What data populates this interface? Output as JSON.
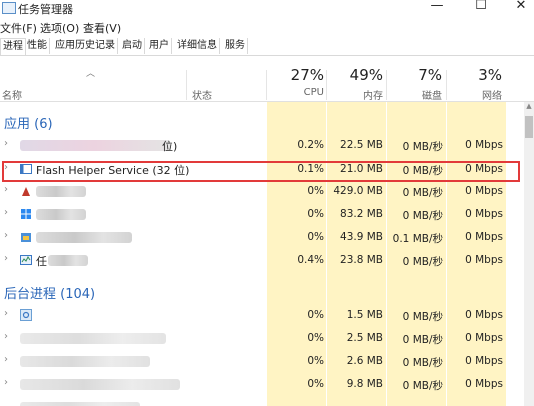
{
  "window": {
    "title": "任务管理器",
    "minimize": "—",
    "maximize": "☐",
    "close": "✕"
  },
  "menu": [
    "文件(F)",
    "选项(O)",
    "查看(V)"
  ],
  "tabs": [
    "进程",
    "性能",
    "应用历史记录",
    "启动",
    "用户",
    "详细信息",
    "服务"
  ],
  "header": {
    "name": "名称",
    "status": "状态",
    "cpu_pct": "27%",
    "cpu": "CPU",
    "mem_pct": "49%",
    "mem": "内存",
    "disk_pct": "7%",
    "disk": "磁盘",
    "net_pct": "3%",
    "net": "网络"
  },
  "groups": {
    "apps": "应用 (6)",
    "background": "后台进程 (104)"
  },
  "apps": [
    {
      "name": "位)",
      "cpu": "0.2%",
      "mem": "22.5 MB",
      "disk": "0 MB/秒",
      "net": "0 Mbps"
    },
    {
      "name": "Flash Helper Service (32 位)",
      "cpu": "0.1%",
      "mem": "21.0 MB",
      "disk": "0 MB/秒",
      "net": "0 Mbps"
    },
    {
      "name": "",
      "cpu": "0%",
      "mem": "429.0 MB",
      "disk": "0 MB/秒",
      "net": "0 Mbps"
    },
    {
      "name": "",
      "cpu": "0%",
      "mem": "83.2 MB",
      "disk": "0 MB/秒",
      "net": "0 Mbps"
    },
    {
      "name": "",
      "cpu": "0%",
      "mem": "43.9 MB",
      "disk": "0.1 MB/秒",
      "net": "0 Mbps"
    },
    {
      "name": "任",
      "cpu": "0.4%",
      "mem": "23.8 MB",
      "disk": "0 MB/秒",
      "net": "0 Mbps"
    }
  ],
  "background": [
    {
      "cpu": "0%",
      "mem": "1.5 MB",
      "disk": "0 MB/秒",
      "net": "0 Mbps"
    },
    {
      "cpu": "0%",
      "mem": "2.5 MB",
      "disk": "0 MB/秒",
      "net": "0 Mbps"
    },
    {
      "cpu": "0%",
      "mem": "2.6 MB",
      "disk": "0 MB/秒",
      "net": "0 Mbps"
    },
    {
      "cpu": "0%",
      "mem": "9.8 MB",
      "disk": "0 MB/秒",
      "net": "0 Mbps"
    }
  ]
}
